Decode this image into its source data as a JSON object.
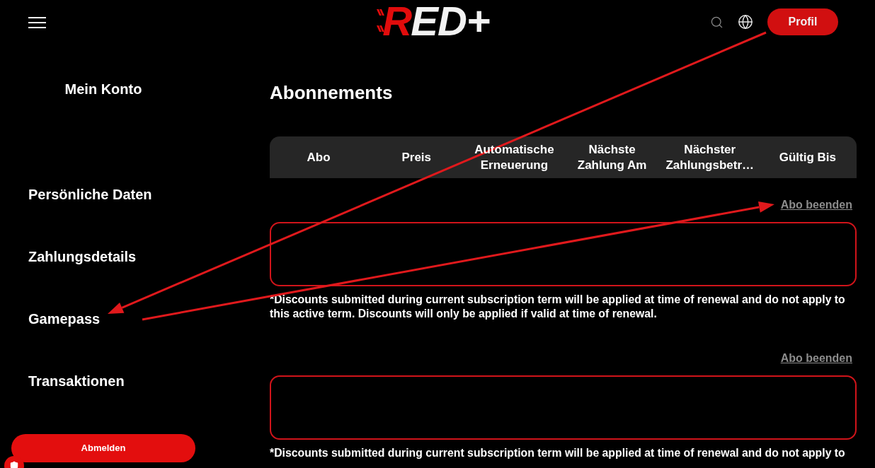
{
  "header": {
    "logo": {
      "accent": "R",
      "text": "ED+"
    },
    "profile_button": "Profil"
  },
  "sidebar": {
    "title": "Mein Konto",
    "items": [
      "Persönliche Daten",
      "Zahlungsdetails",
      "Gamepass",
      "Transaktionen"
    ],
    "logout_button": "Abmelden"
  },
  "main": {
    "title": "Abonnements",
    "table": {
      "columns": [
        "Abo",
        "Preis",
        "Automatische Erneuerung",
        "Nächste Zahlung Am",
        "Nächster Zahlungsbetr…",
        "Gültig Bis"
      ]
    },
    "subscriptions": [
      {
        "action": "Abo beenden",
        "note": "*Discounts submitted during current subscription term will be applied at time of renewal and do not apply to this active term. Discounts will only be applied if valid at time of renewal."
      },
      {
        "action": "Abo beenden",
        "note": "*Discounts submitted during current subscription term will be applied at time of renewal and do not apply to"
      }
    ]
  },
  "annotations": [
    {
      "kind": "arrow"
    },
    {
      "kind": "arrow"
    }
  ]
}
